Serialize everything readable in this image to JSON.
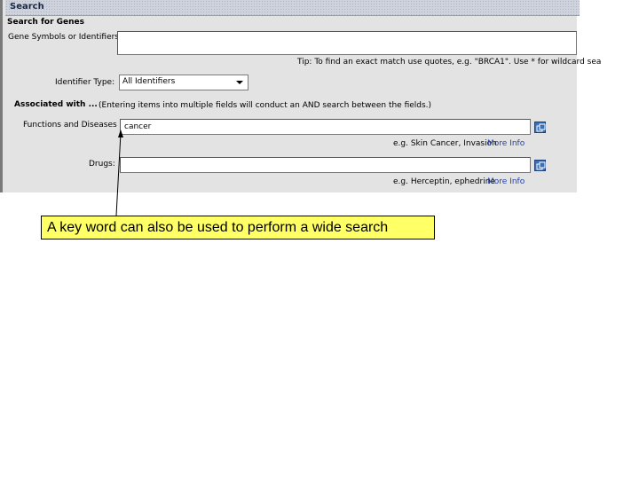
{
  "window": {
    "title": "Search"
  },
  "section": {
    "title": "Search for Genes"
  },
  "gene_symbols": {
    "label": "Gene Symbols or Identifiers",
    "value": ""
  },
  "tip": {
    "text": "Tip: To find an exact match use quotes, e.g. \"BRCA1\". Use * for wildcard sea"
  },
  "identifier_type": {
    "label": "Identifier Type:",
    "selected": "All Identifiers"
  },
  "associated": {
    "title": "Associated with ...",
    "note": "(Entering items into multiple fields will conduct an AND search between the fields.)"
  },
  "functions": {
    "label": "Functions and Diseases",
    "value": "cancer",
    "example": "e.g. Skin Cancer, Invasion",
    "more_info": "More Info"
  },
  "drugs": {
    "label": "Drugs:",
    "value": "",
    "example": "e.g. Herceptin, ephedrine",
    "more_info": "More Info"
  },
  "callout": {
    "text": "A key word can also be used to perform a wide search"
  },
  "icons": {
    "lookup": "lookup-window-icon",
    "dropdown": "chevron-down-icon"
  }
}
